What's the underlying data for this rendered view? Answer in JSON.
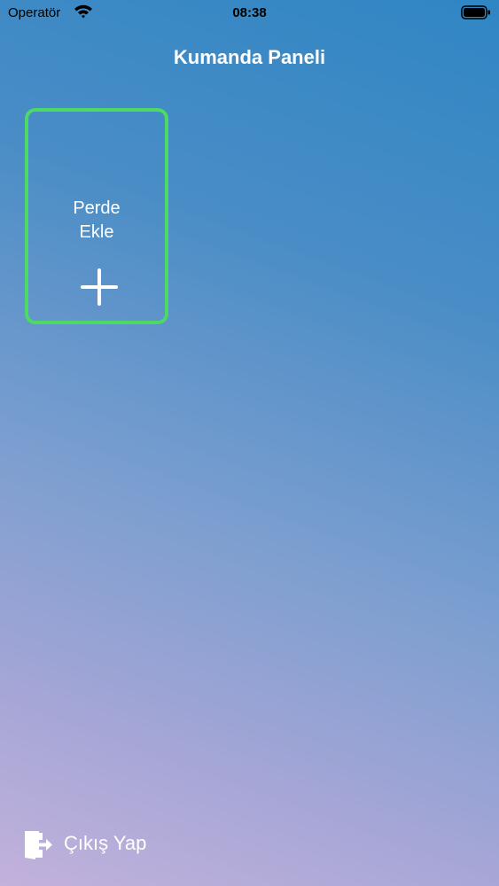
{
  "status_bar": {
    "carrier": "Operatör",
    "time": "08:38",
    "icons": [
      "wifi-icon",
      "battery-icon"
    ]
  },
  "header": {
    "title": "Kumanda Paneli"
  },
  "add_curtain_card": {
    "label": "Perde\nEkle",
    "icon": "plus-icon",
    "border_color": "#4cd964"
  },
  "footer": {
    "logout_label": "Çıkış Yap",
    "logout_icon": "door-exit-icon"
  },
  "colors": {
    "accent_green": "#4cd964",
    "gradient_top": "#2f86c4",
    "gradient_bottom": "#c2b2dc",
    "text": "#ffffff"
  }
}
